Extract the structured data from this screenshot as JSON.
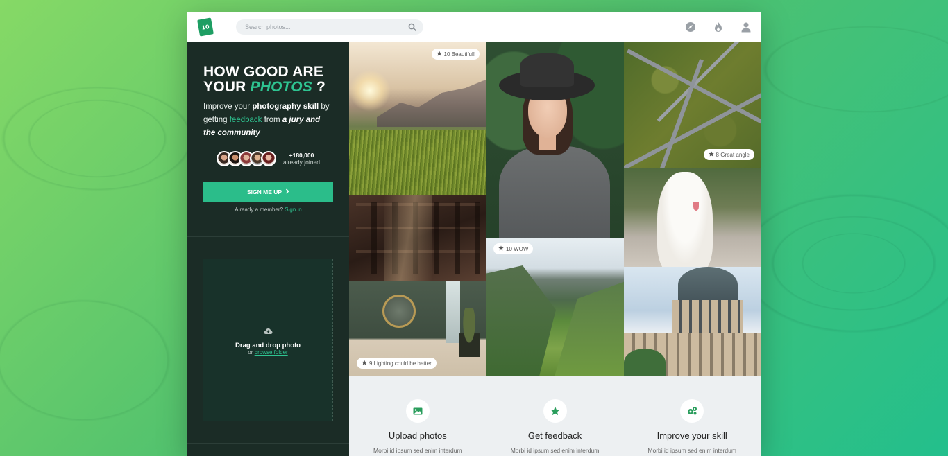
{
  "header": {
    "logo_text": "10",
    "search_placeholder": "Search photos...",
    "icons": [
      "compass-icon",
      "fire-icon",
      "user-icon"
    ]
  },
  "hero": {
    "title_line1": "HOW GOOD ARE",
    "title_line2_pre": "YOUR ",
    "title_accent": "PHOTOS",
    "title_suffix": " ?",
    "text_1": "Improve your ",
    "text_bold": "photography skill",
    "text_2": " by getting ",
    "text_link": "feedback",
    "text_3": " from ",
    "text_italic": "a jury and the community",
    "joined_count": "+180,000",
    "joined_label": "already joined",
    "signup_label": "SIGN ME UP",
    "member_text": "Already a member?",
    "signin_label": "Sign in"
  },
  "dropzone": {
    "title": "Drag and drop photo",
    "or_text": "or",
    "browse_label": "browse folder"
  },
  "badges": {
    "landscape": "10 Beautiful!",
    "roads": "8 Great angle",
    "valley": "10 WOW",
    "bath": "9 Lighting could be better"
  },
  "features": [
    {
      "title": "Upload photos",
      "text": "Morbi id ipsum sed enim interdum",
      "icon": "image-icon"
    },
    {
      "title": "Get feedback",
      "text": "Morbi id ipsum sed enim interdum",
      "icon": "star-icon"
    },
    {
      "title": "Improve your skill",
      "text": "Morbi id ipsum sed enim interdum",
      "icon": "gears-icon"
    }
  ],
  "colors": {
    "accent": "#2bbd8a",
    "sidebar_bg": "#1b2c26",
    "icon_green": "#2a9d5c"
  }
}
